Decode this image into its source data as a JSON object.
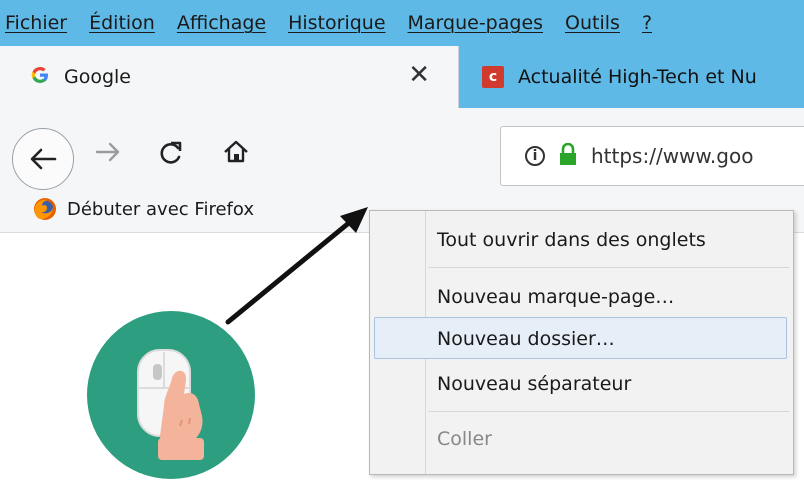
{
  "menubar": {
    "items": [
      {
        "label": "Fichier"
      },
      {
        "label": "Édition"
      },
      {
        "label": "Affichage"
      },
      {
        "label": "Historique"
      },
      {
        "label": "Marque-pages"
      },
      {
        "label": "Outils"
      },
      {
        "label": "?"
      }
    ]
  },
  "tabs": {
    "active": {
      "icon": "google-icon",
      "title": "Google",
      "close": "✕"
    },
    "inactive": {
      "icon": "clubic-icon",
      "icon_letter": "c",
      "title": "Actualité High-Tech et Nu"
    }
  },
  "navigation": {
    "back_icon": "back-arrow-icon",
    "forward_icon": "forward-arrow-icon",
    "reload_icon": "reload-icon",
    "home_icon": "home-icon",
    "url": "https://www.goo",
    "info_icon": "info-icon",
    "lock_icon": "lock-icon",
    "lock_color": "#2aa52a"
  },
  "bookmarks_bar": {
    "items": [
      {
        "label": "Débuter avec Firefox",
        "icon": "firefox-icon"
      }
    ]
  },
  "context_menu": {
    "items": [
      {
        "label": "Tout ouvrir dans des onglets"
      },
      {
        "label": "Nouveau marque-page…"
      },
      {
        "label": "Nouveau dossier…",
        "highlighted": true
      },
      {
        "label": "Nouveau séparateur"
      },
      {
        "label": "Coller",
        "disabled": true
      }
    ]
  },
  "colors": {
    "menubar_bg": "#5fb9e6",
    "toolbar_bg": "#f5f6f7",
    "illustration_bg": "#2e9e80"
  }
}
